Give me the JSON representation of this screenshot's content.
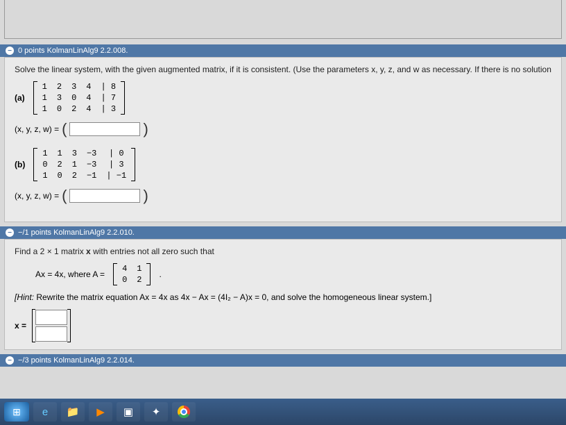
{
  "q2": {
    "header": "0 points  KolmanLinAlg9 2.2.008.",
    "prompt": "Solve the linear system, with the given augmented matrix, if it is consistent. (Use the parameters x, y, z, and w as necessary. If there is no solution",
    "part_a_label": "(a)",
    "matrix_a": [
      [
        "1",
        "2",
        "3",
        "4",
        "8"
      ],
      [
        "1",
        "3",
        "0",
        "4",
        "7"
      ],
      [
        "1",
        "0",
        "2",
        "4",
        "3"
      ]
    ],
    "ans_label_a": "(x, y, z, w) = ",
    "part_b_label": "(b)",
    "matrix_b": [
      [
        "1",
        "1",
        "3",
        "−3",
        "0"
      ],
      [
        "0",
        "2",
        "1",
        "−3",
        "3"
      ],
      [
        "1",
        "0",
        "2",
        "−1",
        "−1"
      ]
    ],
    "ans_label_b": "(x, y, z, w) = "
  },
  "q3": {
    "header": "−/1 points  KolmanLinAlg9 2.2.010.",
    "prompt_prefix": "Find a 2 × 1 matrix ",
    "prompt_bold": "x",
    "prompt_suffix": " with entries not all zero such that",
    "eq_left": "Ax = 4x,   where A = ",
    "matrix_A2": [
      [
        "4",
        "1"
      ],
      [
        "0",
        "2"
      ]
    ],
    "hint_open": "[Hint:",
    "hint_rest": " Rewrite the matrix equation  Ax = 4x  as  4x − Ax = (4I₂ − A)x = 0,  and solve the homogeneous linear system.]",
    "x_label": "x = "
  },
  "q4": {
    "header": "−/3 points  KolmanLinAlg9 2.2.014."
  },
  "chart_data": {
    "type": "table",
    "title": "Augmented matrices for linear systems",
    "tables": [
      {
        "name": "matrix_a",
        "columns": [
          "c1",
          "c2",
          "c3",
          "c4",
          "aug"
        ],
        "rows": [
          [
            1,
            2,
            3,
            4,
            8
          ],
          [
            1,
            3,
            0,
            4,
            7
          ],
          [
            1,
            0,
            2,
            4,
            3
          ]
        ]
      },
      {
        "name": "matrix_b",
        "columns": [
          "c1",
          "c2",
          "c3",
          "c4",
          "aug"
        ],
        "rows": [
          [
            1,
            1,
            3,
            -3,
            0
          ],
          [
            0,
            2,
            1,
            -3,
            3
          ],
          [
            1,
            0,
            2,
            -1,
            -1
          ]
        ]
      },
      {
        "name": "A",
        "columns": [
          "c1",
          "c2"
        ],
        "rows": [
          [
            4,
            1
          ],
          [
            0,
            2
          ]
        ]
      }
    ]
  }
}
